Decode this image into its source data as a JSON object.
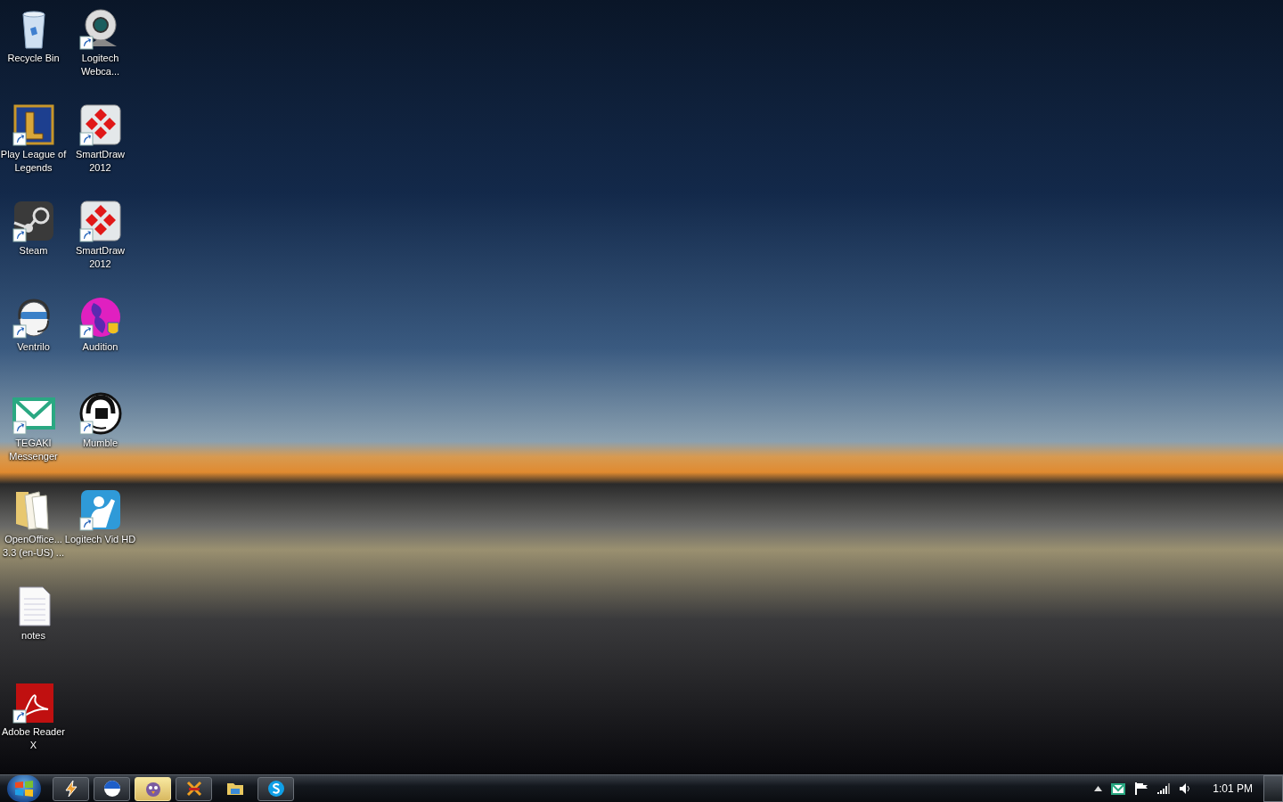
{
  "desktop_icons": [
    {
      "label": "Recycle Bin",
      "kind": "recycle-bin",
      "shortcut": false
    },
    {
      "label": "Play League of Legends",
      "kind": "game",
      "shortcut": true
    },
    {
      "label": "Steam",
      "kind": "steam",
      "shortcut": true
    },
    {
      "label": "Ventrilo",
      "kind": "headset",
      "shortcut": true
    },
    {
      "label": "TEGAKI Messenger",
      "kind": "mail",
      "shortcut": true
    },
    {
      "label": "OpenOffice... 3.3 (en-US) ...",
      "kind": "folder",
      "shortcut": false
    },
    {
      "label": "notes",
      "kind": "document",
      "shortcut": false
    },
    {
      "label": "Adobe Reader X",
      "kind": "pdf",
      "shortcut": true
    },
    {
      "label": "Logitech Webca...",
      "kind": "webcam",
      "shortcut": true
    },
    {
      "label": "SmartDraw 2012",
      "kind": "diagram",
      "shortcut": true
    },
    {
      "label": "SmartDraw 2012",
      "kind": "diagram",
      "shortcut": true
    },
    {
      "label": "Audition",
      "kind": "shield-app",
      "shortcut": true
    },
    {
      "label": "Mumble",
      "kind": "microphone",
      "shortcut": true
    },
    {
      "label": "Logitech Vid HD",
      "kind": "person",
      "shortcut": true
    }
  ],
  "taskbar": {
    "items": [
      {
        "kind": "bolt",
        "running": true,
        "selected": false
      },
      {
        "kind": "globe",
        "running": true,
        "selected": false
      },
      {
        "kind": "penguin",
        "running": true,
        "selected": true
      },
      {
        "kind": "cross",
        "running": true,
        "selected": false
      },
      {
        "kind": "folder",
        "running": false,
        "selected": false
      },
      {
        "kind": "skype",
        "running": true,
        "selected": false
      }
    ],
    "tray": {
      "clock": "1:01 PM"
    }
  }
}
